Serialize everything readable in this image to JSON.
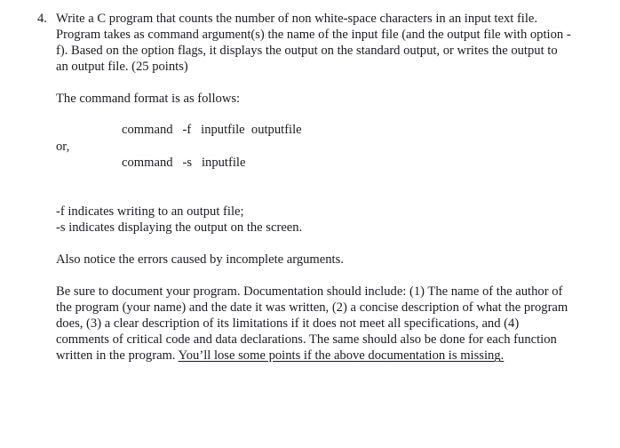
{
  "document": {
    "item_number": "4.",
    "intro_paragraph": "Write a C program that counts the number of non white-space characters in an input text file.  Program takes as command argument(s) the name of the input file (and the output file with option -f). Based on the option flags, it displays the output on the standard output, or writes the output to an output file.  (25 points)",
    "command_format_intro": "The command format is as follows:",
    "command_lines": {
      "first": "command   -f   inputfile  outputfile",
      "or_label": "or,",
      "second": "command   -s   inputfile"
    },
    "flag_descriptions": [
      "-f indicates writing to an output file;",
      "-s indicates displaying the output on the screen."
    ],
    "errors_note": "Also notice the errors caused by incomplete arguments.",
    "documentation_paragraph": "Be sure to document your program. Documentation should include: (1) The name of the author of the program (your name) and the date it was written, (2) a concise description of what the program does, (3) a clear description of its limitations if it does not meet all specifications, and (4) comments of critical code and data declarations. The same should also be done for each function written in the program. ",
    "documentation_warning": "You’ll lose some points if the above documentation is missing."
  },
  "style": {
    "background_color": "#ffffff",
    "text_color": "#1a1a22"
  }
}
